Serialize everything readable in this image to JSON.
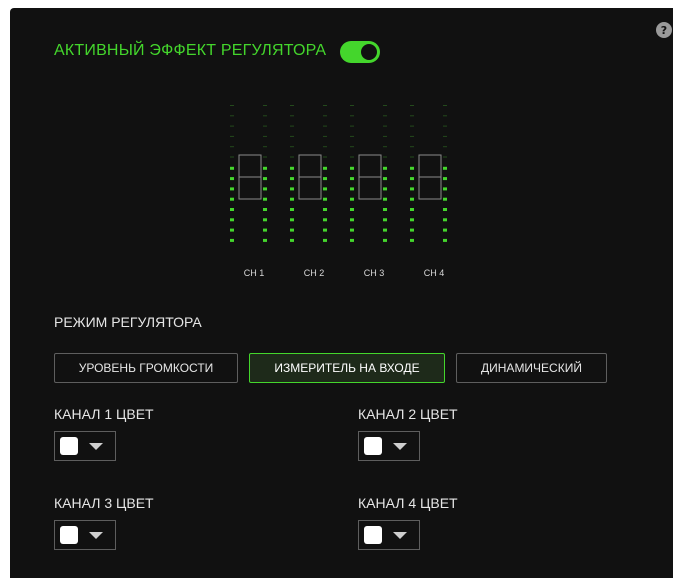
{
  "header": {
    "title": "АКТИВНЫЙ ЭФФЕКТ РЕГУЛЯТОРА",
    "toggle_on": true,
    "help_icon": "?"
  },
  "equalizer": {
    "channels": [
      {
        "label": "CH 1",
        "level": 0.6
      },
      {
        "label": "CH 2",
        "level": 0.6
      },
      {
        "label": "CH 3",
        "level": 0.6
      },
      {
        "label": "CH 4",
        "level": 0.6
      }
    ],
    "active_color": "#44d62c",
    "inactive_color": "#244a1c"
  },
  "mode": {
    "label": "РЕЖИМ РЕГУЛЯТОРА",
    "buttons": [
      {
        "label": "УРОВЕНЬ ГРОМКОСТИ",
        "active": false
      },
      {
        "label": "ИЗМЕРИТЕЛЬ НА ВХОДЕ",
        "active": true
      },
      {
        "label": "ДИНАМИЧЕСКИЙ",
        "active": false
      }
    ]
  },
  "channels": [
    {
      "label": "КАНАЛ 1 ЦВЕТ",
      "color": "#ffffff"
    },
    {
      "label": "КАНАЛ 2 ЦВЕТ",
      "color": "#ffffff"
    },
    {
      "label": "КАНАЛ 3 ЦВЕТ",
      "color": "#ffffff"
    },
    {
      "label": "КАНАЛ 4 ЦВЕТ",
      "color": "#ffffff"
    }
  ],
  "colors": {
    "accent": "#44d62c",
    "panel": "#111111"
  }
}
